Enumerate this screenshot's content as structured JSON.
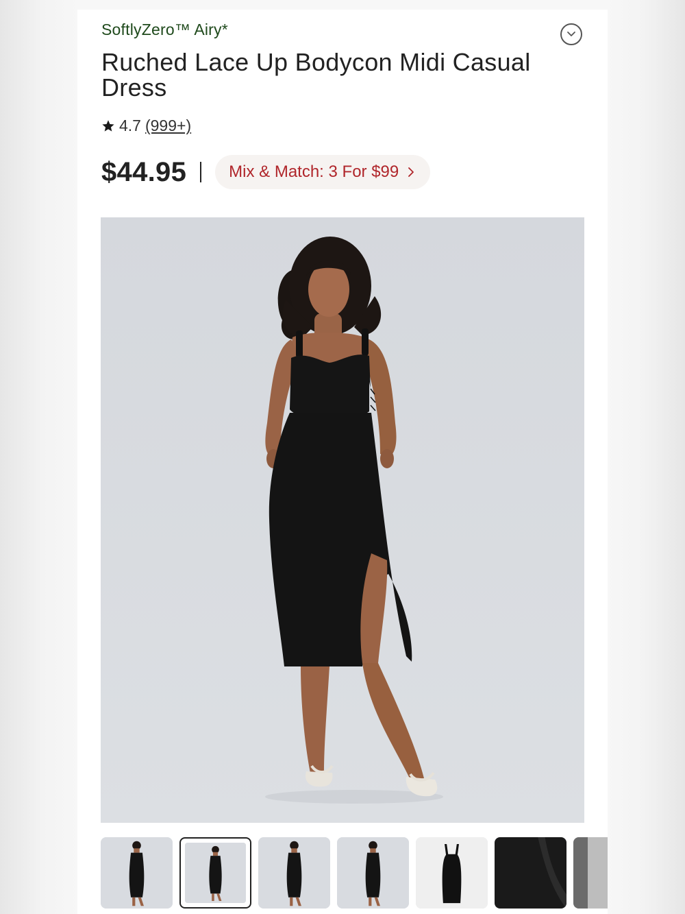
{
  "product": {
    "brand": "SoftlyZero™ Airy*",
    "title": "Ruched Lace Up Bodycon Midi Casual Dress",
    "rating": "4.7",
    "review_count": "(999+)",
    "price": "$44.95",
    "promo_label": "Mix & Match: 3 For $99",
    "gallery": {
      "thumbnail_count": 7,
      "selected_index": 1
    }
  },
  "icons": {
    "collapse": "chevron-down-circle-icon",
    "rating": "star-icon",
    "promo": "chevron-right-icon"
  },
  "colors": {
    "brand_text": "#1f4a1c",
    "promo_text": "#b0262b",
    "promo_bg": "#f6f3f1",
    "image_bg": "#d7dadf"
  }
}
